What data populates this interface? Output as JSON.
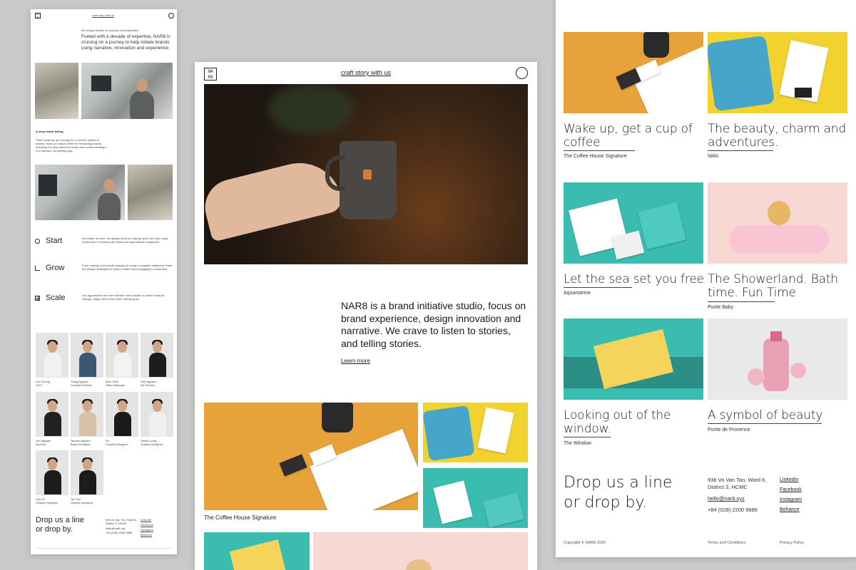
{
  "header": {
    "tagline": "craft story with us",
    "logo_text": "NA R8"
  },
  "p1": {
    "intro_small": "We design brands on purpose and inspiration",
    "intro_lead": "Fueled with a decade of expertise, NAR8 is cruising on a journey to help initiate brands using narrative, innovation and experience.",
    "story_heading": "A story worth telling",
    "story_text": "That's what we are striving for: to tell the stories of brands; that's our raison d'être for remaining curious, unfolding the story behind a brand and communicating it in a relevant, compelling way.",
    "steps": [
      {
        "label": "Start",
        "icon": "power-icon",
        "text": "No matter the size, we always keep our startup spirit. We have huge excitement in working with small and inspirational companies."
      },
      {
        "label": "Grow",
        "icon": "growth-chart-icon",
        "text": "From making a few small changes to doing a complete makeover, there are always strategies to make a brand more engaging to customers."
      },
      {
        "label": "Scale",
        "icon": "scale-grid-icon",
        "text": "Our approaches are more flexible and modular to make it easy to change, adapt and evolve when brands grow."
      }
    ],
    "team": [
      {
        "name": "Duc Duong",
        "role": "CEO"
      },
      {
        "name": "Trung Nguyen",
        "role": "Creative Director"
      },
      {
        "name": "Binh Trinh",
        "role": "Office Manager"
      },
      {
        "name": "Huy Nguyen",
        "role": "Art Director"
      },
      {
        "name": "Jen Nguyen",
        "role": "Account"
      },
      {
        "name": "Tammy Nguyen",
        "role": "Brand Designer"
      },
      {
        "name": "Ka",
        "role": "Graphic Designer"
      },
      {
        "name": "Stella Luong",
        "role": "Graphic Designer"
      },
      {
        "name": "Huy Vo",
        "role": "Graphic Designer"
      },
      {
        "name": "Tai Tran",
        "role": "Graphic Designer"
      }
    ],
    "contact_heading": "Drop us a line or drop by.",
    "address": "93b Vo Van Tan, Ward 6, District 3, HCMC",
    "email": "hello@nar8.xyz",
    "phone": "+84 (028) 2200 9686",
    "socials": [
      "LinkedIn",
      "Facebook",
      "Instagram",
      "Behance"
    ]
  },
  "p2": {
    "statement": "NAR8 is a brand initiative studio, focus on brand experience, design innovation and narrative. We crave to listen to stories, and telling stories.",
    "learn_more": "Learn more",
    "project_caption": "The Coffee House Signature"
  },
  "p3": {
    "projects": [
      {
        "title": "Wake up, get a cup of coffee",
        "client": "The Coffee House Signature",
        "tone": "orange"
      },
      {
        "title": "The beauty, charm and adventures.",
        "client": "Nikki",
        "tone": "yellow"
      },
      {
        "title": "Let the sea set you free",
        "client": "Aquamarine",
        "tone": "teal"
      },
      {
        "title": "The Showerland. Bath time. Fun Time",
        "client": "Purite Baby",
        "tone": "pink"
      },
      {
        "title": "Looking out of the window.",
        "client": "The Window",
        "tone": "teal"
      },
      {
        "title": "A symbol of beauty",
        "client": "Purite de Provence",
        "tone": "grey"
      }
    ],
    "contact_heading": "Drop us a line or drop by.",
    "address": "93b Vo Van Tan, Ward 6, District 3, HCMC",
    "email": "hello@nar8.xyz",
    "phone": "+84 (028) 2200 9686",
    "socials": [
      "LinkedIn",
      "Facebook",
      "Instagram",
      "Behance"
    ],
    "copyright": "Copyright © NAR8 2020",
    "terms": "Terms and Conditions",
    "privacy": "Privacy Policy"
  },
  "colors": {
    "background": "#c9c9c9",
    "orange": "#e8a23a",
    "yellow": "#f2d22e",
    "teal": "#3bbcb0",
    "pink": "#f7d8d2"
  }
}
